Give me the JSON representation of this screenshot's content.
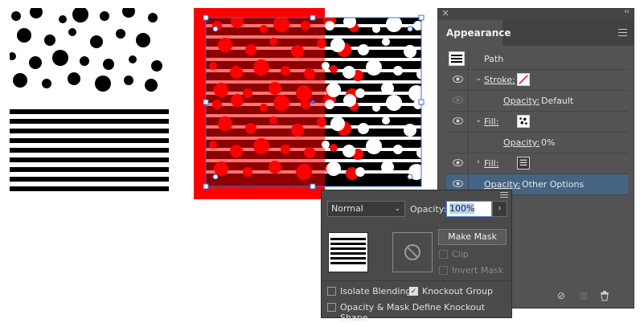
{
  "panel": {
    "close_glyph": "×",
    "collapse_glyph": "‹‹",
    "tab": "Appearance",
    "rows": {
      "path": "Path",
      "stroke": "Stroke:",
      "stroke_opacity": "Opacity:",
      "stroke_opacity_value": "Default",
      "fill1": "Fill:",
      "fill1_opacity": "Opacity:",
      "fill1_opacity_value": "0%",
      "fill2": "Fill:",
      "opacity": "Opacity:",
      "opacity_value": "Other Options"
    }
  },
  "popup": {
    "blend_mode": "Normal",
    "opacity_label": "Opacity:",
    "opacity_value": "100%",
    "make_mask": "Make Mask",
    "clip": "Clip",
    "invert_mask": "Invert Mask",
    "isolate_blending": "Isolate Blending",
    "knockout_group": "Knockout Group",
    "knockout_shape": "Opacity & Mask Define Knockout Shape",
    "knockout_checked": true
  },
  "colors": {
    "selection": "#456484",
    "accent": "#4d8be0",
    "art_red": "#ff0000"
  }
}
